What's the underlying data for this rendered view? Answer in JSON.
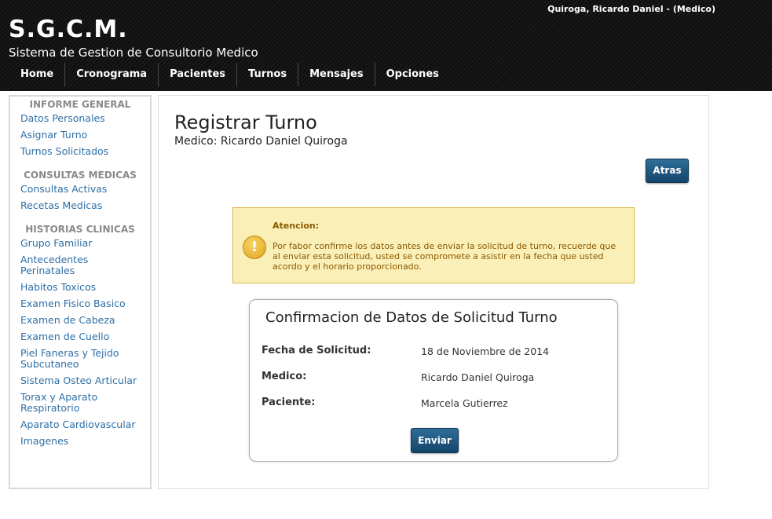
{
  "header": {
    "user": "Quiroga, Ricardo Daniel - (Medico)",
    "logo": "S.G.C.M.",
    "subtitle": "Sistema de Gestion de Consultorio Medico",
    "nav": [
      "Home",
      "Cronograma",
      "Pacientes",
      "Turnos",
      "Mensajes",
      "Opciones"
    ]
  },
  "sidebar": {
    "sections": [
      {
        "heading": "INFORME GENERAL",
        "links": [
          "Datos Personales",
          "Asignar Turno",
          "Turnos Solicitados"
        ]
      },
      {
        "heading": "CONSULTAS MEDICAS",
        "links": [
          "Consultas Activas",
          "Recetas Medicas"
        ]
      },
      {
        "heading": "HISTORIAS CLINICAS",
        "links": [
          "Grupo Familiar",
          "Antecedentes Perinatales",
          "Habitos Toxicos",
          "Examen Fisico Basico",
          "Examen de Cabeza",
          "Examen de Cuello",
          "Piel Faneras y Tejido Subcutaneo",
          "Sistema Osteo Articular",
          "Torax y Aparato Respiratorio",
          "Aparato Cardiovascular",
          "Imagenes"
        ]
      }
    ]
  },
  "main": {
    "title": "Registrar Turno",
    "subtitle": "Medico: Ricardo Daniel Quiroga",
    "back_label": "Atras",
    "alert": {
      "title": "Atencion:",
      "text": "Por fabor confirme los datos antes de enviar la solicitud de turno, recuerde que al enviar esta solicitud, usted se compromete a asistir en la fecha que usted acordo y el horario proporcionado.",
      "icon_glyph": "!"
    },
    "confirm": {
      "title": "Confirmacion de Datos de Solicitud Turno",
      "fields": [
        {
          "label": "Fecha de Solicitud:",
          "value": "18 de Noviembre de 2014"
        },
        {
          "label": "Medico:",
          "value": "Ricardo Daniel Quiroga"
        },
        {
          "label": "Paciente:",
          "value": "Marcela Gutierrez"
        }
      ],
      "submit_label": "Enviar"
    }
  },
  "colors": {
    "header_bg": "#141414",
    "link": "#2e6fa7",
    "button": "#1d5580",
    "alert_bg": "#fbefb8",
    "alert_text": "#8a5a00"
  }
}
